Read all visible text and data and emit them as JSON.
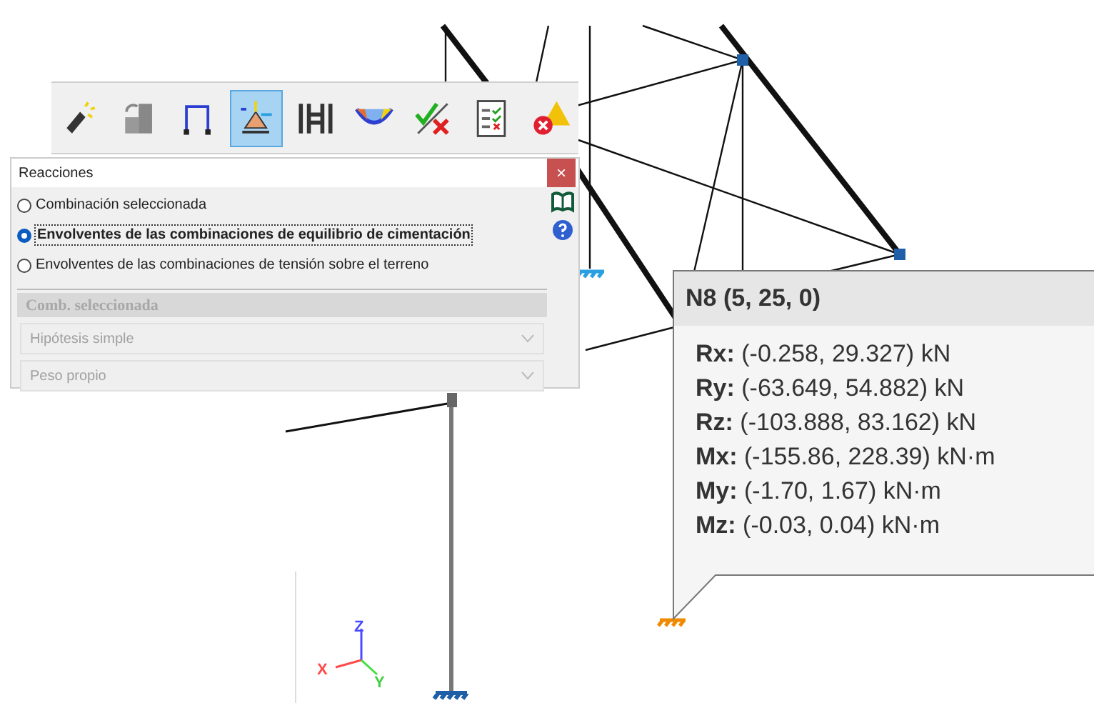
{
  "toolbar": {
    "buttons": [
      {
        "kind": "wand",
        "selected": false
      },
      {
        "kind": "refresh",
        "selected": false
      },
      {
        "kind": "frame",
        "selected": false
      },
      {
        "kind": "reaction",
        "selected": true
      },
      {
        "kind": "profile",
        "selected": false
      },
      {
        "kind": "deformed",
        "selected": false
      },
      {
        "kind": "check",
        "selected": false
      },
      {
        "kind": "list",
        "selected": false
      },
      {
        "kind": "warning",
        "selected": false
      }
    ]
  },
  "panel": {
    "title": "Reacciones",
    "close": "×",
    "disabled": true,
    "options": [
      {
        "label": "Combinación seleccionada",
        "selected": false
      },
      {
        "label": "Envolventes de las combinaciones de equilibrio de cimentación",
        "selected": true
      },
      {
        "label": "Envolventes de las combinaciones de tensión sobre el terreno",
        "selected": false
      }
    ],
    "section": "Comb. seleccionada",
    "dropdowns": [
      "Hipótesis simple",
      "Peso propio"
    ]
  },
  "tooltip": {
    "title": "N8 (5, 25, 0)",
    "rows": [
      {
        "label": "Rx:",
        "value": "(-0.258, 29.327) kN"
      },
      {
        "label": "Ry:",
        "value": "(-63.649, 54.882) kN"
      },
      {
        "label": "Rz:",
        "value": "(-103.888, 83.162) kN"
      },
      {
        "label": "Mx:",
        "value": "(-155.86, 228.39) kN·m"
      },
      {
        "label": "My:",
        "value": "(-1.70, 1.67) kN·m"
      },
      {
        "label": "Mz:",
        "value": "(-0.03, 0.04) kN·m"
      }
    ]
  },
  "axes": {
    "x": "X",
    "y": "Y",
    "z": "Z"
  }
}
